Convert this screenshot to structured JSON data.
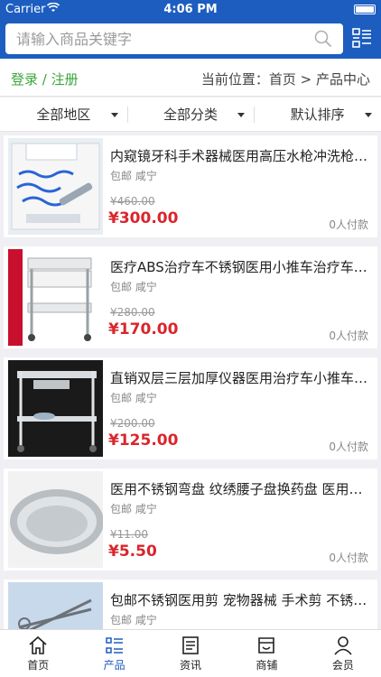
{
  "status": {
    "carrier": "Carrier",
    "time": "4:06 PM"
  },
  "search": {
    "placeholder": "请输入商品关键字"
  },
  "topbar": {
    "login": "登录 / 注册",
    "position": "当前位置：首页 > 产品中心"
  },
  "filters": [
    {
      "label": "全部地区"
    },
    {
      "label": "全部分类"
    },
    {
      "label": "默认排序"
    }
  ],
  "products": [
    {
      "title": "内窥镜牙科手术器械医用高压水枪冲洗枪…",
      "meta": "包邮 咸宁",
      "original_price": "¥460.00",
      "price": "¥300.00",
      "paid": "0人付款",
      "image": "dental-kit"
    },
    {
      "title": "医疗ABS治疗车不锈钢医用小推车治疗车…",
      "meta": "包邮 咸宁",
      "original_price": "¥280.00",
      "price": "¥170.00",
      "paid": "0人付款",
      "image": "abs-cart"
    },
    {
      "title": "直销双层三层加厚仪器医用治疗车小推车…",
      "meta": "包邮 咸宁",
      "original_price": "¥200.00",
      "price": "¥125.00",
      "paid": "0人付款",
      "image": "steel-cart"
    },
    {
      "title": "医用不锈钢弯盘 纹绣腰子盘换药盘 医用…",
      "meta": "包邮 咸宁",
      "original_price": "¥11.00",
      "price": "¥5.50",
      "paid": "0人付款",
      "image": "kidney-dish"
    },
    {
      "title": "包邮不锈钢医用剪 宠物器械 手术剪 不锈…",
      "meta": "包邮 咸宁",
      "original_price": "",
      "price": "",
      "paid": "",
      "image": "scissors"
    }
  ],
  "tabs": [
    {
      "label": "首页",
      "icon": "home-icon"
    },
    {
      "label": "产品",
      "icon": "list-icon"
    },
    {
      "label": "资讯",
      "icon": "news-icon"
    },
    {
      "label": "商铺",
      "icon": "shop-icon"
    },
    {
      "label": "会员",
      "icon": "user-icon"
    }
  ],
  "colors": {
    "primary": "#1d5dc0",
    "price": "#d9262c",
    "login": "#3aa63a"
  }
}
